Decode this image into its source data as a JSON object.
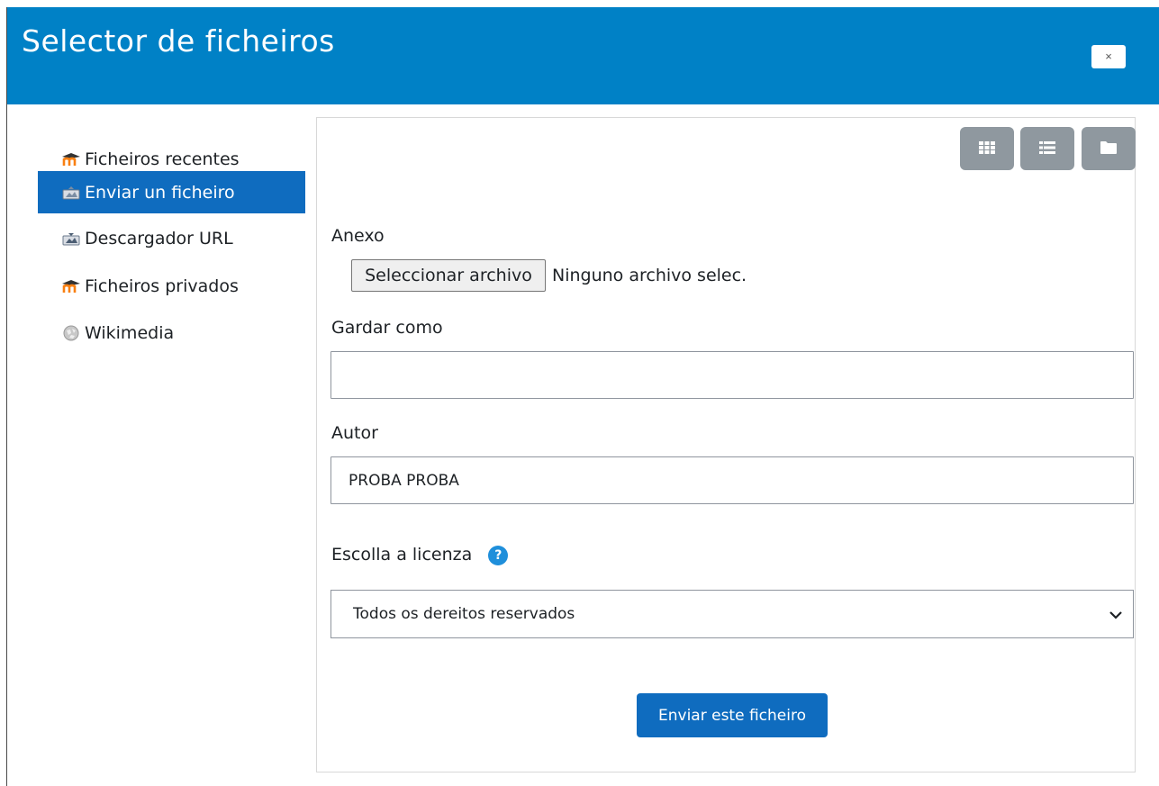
{
  "dialog": {
    "title": "Selector de ficheiros",
    "close_label": "×"
  },
  "sidebar": {
    "items": [
      {
        "label": "Ficheiros recentes",
        "icon": "moodle-icon",
        "active": false
      },
      {
        "label": "Enviar un ficheiro",
        "icon": "upload-icon",
        "active": true
      },
      {
        "label": "Descargador URL",
        "icon": "url-download-icon",
        "active": false
      },
      {
        "label": "Ficheiros privados",
        "icon": "moodle-icon",
        "active": false
      },
      {
        "label": "Wikimedia",
        "icon": "wikimedia-icon",
        "active": false
      }
    ]
  },
  "toolbar": {
    "views": [
      "grid-view-icon",
      "list-view-icon",
      "folder-view-icon"
    ]
  },
  "form": {
    "attachment_label": "Anexo",
    "file_button_label": "Seleccionar archivo",
    "file_status": "Ninguno archivo selec.",
    "save_as_label": "Gardar como",
    "save_as_value": "",
    "author_label": "Autor",
    "author_value": "PROBA PROBA",
    "license_label": "Escolla a licenza",
    "help_icon": "?",
    "license_value": "Todos os dereitos reservados",
    "submit_label": "Enviar este ficheiro"
  },
  "colors": {
    "header": "#0081c6",
    "active_item": "#0f6cbf",
    "primary_button": "#0f6cbf",
    "view_button": "#8f989f"
  }
}
